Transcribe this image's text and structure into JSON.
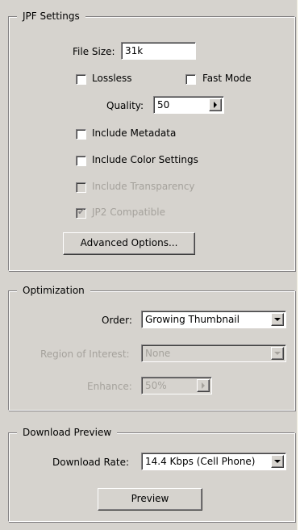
{
  "jpf": {
    "legend": "JPF Settings",
    "file_size_label": "File Size:",
    "file_size_value": "31k",
    "lossless_label": "Lossless",
    "fast_mode_label": "Fast Mode",
    "quality_label": "Quality:",
    "quality_value": "50",
    "include_metadata_label": "Include Metadata",
    "include_color_settings_label": "Include Color Settings",
    "include_transparency_label": "Include Transparency",
    "jp2_compatible_label": "JP2 Compatible",
    "jp2_compatible_checked": true,
    "advanced_options_label": "Advanced Options..."
  },
  "optimization": {
    "legend": "Optimization",
    "order_label": "Order:",
    "order_value": "Growing Thumbnail",
    "region_label": "Region of Interest:",
    "region_value": "None",
    "enhance_label": "Enhance:",
    "enhance_value": "50%"
  },
  "download_preview": {
    "legend": "Download Preview",
    "rate_label": "Download Rate:",
    "rate_value": "14.4 Kbps (Cell Phone)",
    "preview_label": "Preview"
  },
  "colors": {
    "face": "#d6d3ce",
    "disabled_text": "#a5a29c"
  }
}
